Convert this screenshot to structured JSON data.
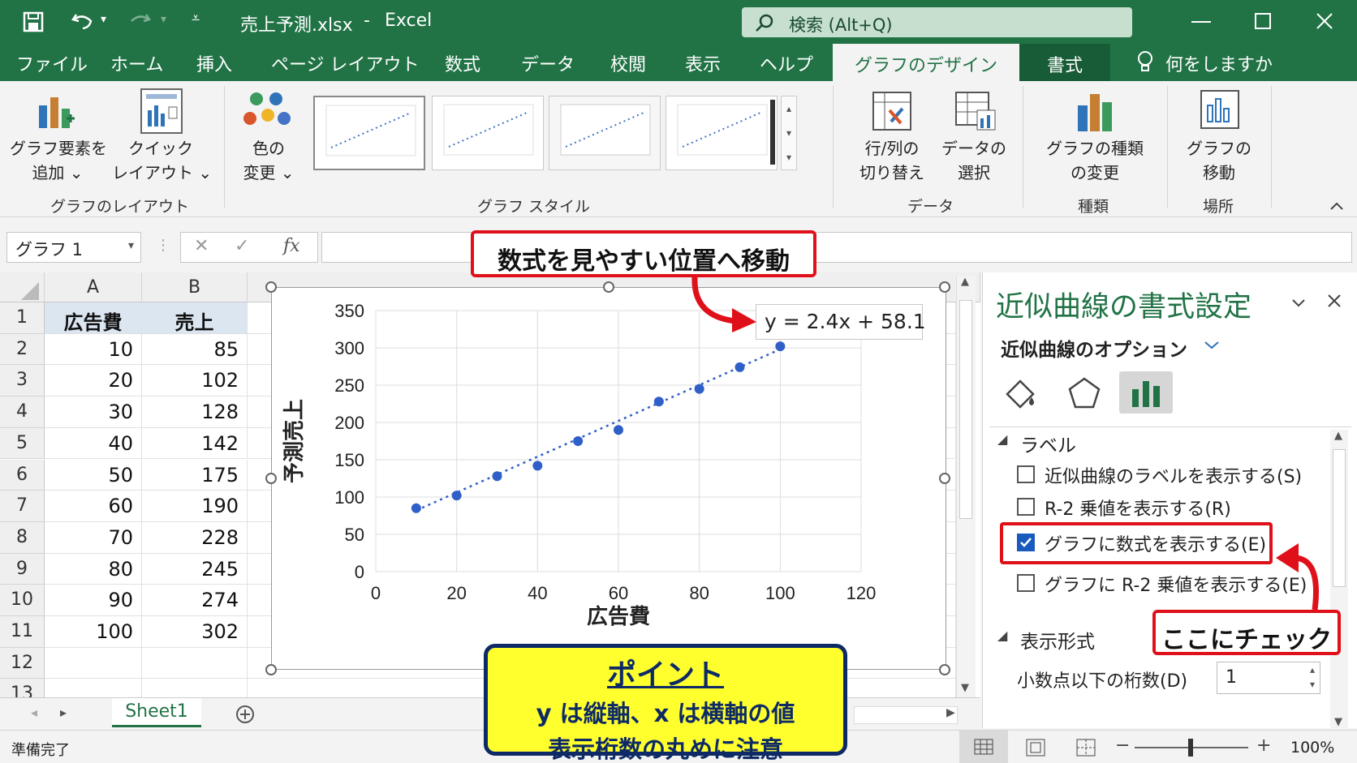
{
  "window": {
    "filename": "売上予測.xlsx",
    "separator": "-",
    "app": "Excel",
    "search_placeholder": "検索 (Alt+Q)"
  },
  "tabs": [
    "ファイル",
    "ホーム",
    "挿入",
    "ページ レイアウト",
    "数式",
    "データ",
    "校閲",
    "表示",
    "ヘルプ"
  ],
  "tab_active": "グラフのデザイン",
  "tab_format": "書式",
  "tell_me": "何をしますか",
  "ribbon": {
    "add_element": [
      "グラフ要素を",
      "追加 ⌄"
    ],
    "quick_layout": [
      "クイック",
      "レイアウト ⌄"
    ],
    "group_layout": "グラフのレイアウト",
    "change_colors": [
      "色の",
      "変更 ⌄"
    ],
    "group_styles": "グラフ スタイル",
    "switch_row_col": [
      "行/列の",
      "切り替え"
    ],
    "select_data": [
      "データの",
      "選択"
    ],
    "group_data": "データ",
    "change_type": [
      "グラフの種類",
      "の変更"
    ],
    "group_type": "種類",
    "move_chart": [
      "グラフの",
      "移動"
    ],
    "group_location": "場所"
  },
  "namebox": "グラフ 1",
  "fx": "fx",
  "columns": [
    "A",
    "B"
  ],
  "rows": [
    "1",
    "2",
    "3",
    "4",
    "5",
    "6",
    "7",
    "8",
    "9",
    "10",
    "11",
    "12",
    "13"
  ],
  "table": {
    "headers": [
      "広告費",
      "売上"
    ],
    "data": [
      [
        "10",
        "85"
      ],
      [
        "20",
        "102"
      ],
      [
        "30",
        "128"
      ],
      [
        "40",
        "142"
      ],
      [
        "50",
        "175"
      ],
      [
        "60",
        "190"
      ],
      [
        "70",
        "228"
      ],
      [
        "80",
        "245"
      ],
      [
        "90",
        "274"
      ],
      [
        "100",
        "302"
      ]
    ]
  },
  "chart_data": {
    "type": "scatter",
    "x": [
      10,
      20,
      30,
      40,
      50,
      60,
      70,
      80,
      90,
      100
    ],
    "y": [
      85,
      102,
      128,
      142,
      175,
      190,
      228,
      245,
      274,
      302
    ],
    "xlabel": "広告費",
    "ylabel": "予測売上",
    "xlim": [
      0,
      120
    ],
    "ylim": [
      0,
      350
    ],
    "xticks": [
      "0",
      "20",
      "40",
      "60",
      "80",
      "100",
      "120"
    ],
    "yticks": [
      "0",
      "50",
      "100",
      "150",
      "200",
      "250",
      "300",
      "350"
    ],
    "trendline": "linear, dotted",
    "equation": "y = 2.4x + 58.1",
    "grid": true,
    "marker_color": "#2f5fc8"
  },
  "pane": {
    "title": "近似曲線の書式設定",
    "section": "近似曲線のオプション",
    "label_group": "ラベル",
    "options": [
      {
        "text": "近似曲線のラベルを表示する(S)",
        "checked": false
      },
      {
        "text": "R-2 乗値を表示する(R)",
        "checked": false
      },
      {
        "text": "グラフに数式を表示する(E)",
        "checked": true
      },
      {
        "text": "グラフに R-2 乗値を表示する(E)",
        "checked": false
      }
    ],
    "format_group": "表示形式",
    "decimals_label": "小数点以下の桁数(D)",
    "decimals_value": "1"
  },
  "sheet_tab": "Sheet1",
  "status": {
    "ready": "準備完了",
    "zoom": "100%"
  },
  "callouts": {
    "move": "数式を見やすい位置へ移動",
    "check": "ここにチェック",
    "point_title": "ポイント",
    "point_line1": "y は縦軸、x は横軸の値",
    "point_line2": "表示桁数の丸めに注意"
  },
  "colors": {
    "excel_green": "#217346",
    "accent_red": "#e0101a",
    "point_yellow": "#ffff2e",
    "point_navy": "#0d2a66"
  }
}
